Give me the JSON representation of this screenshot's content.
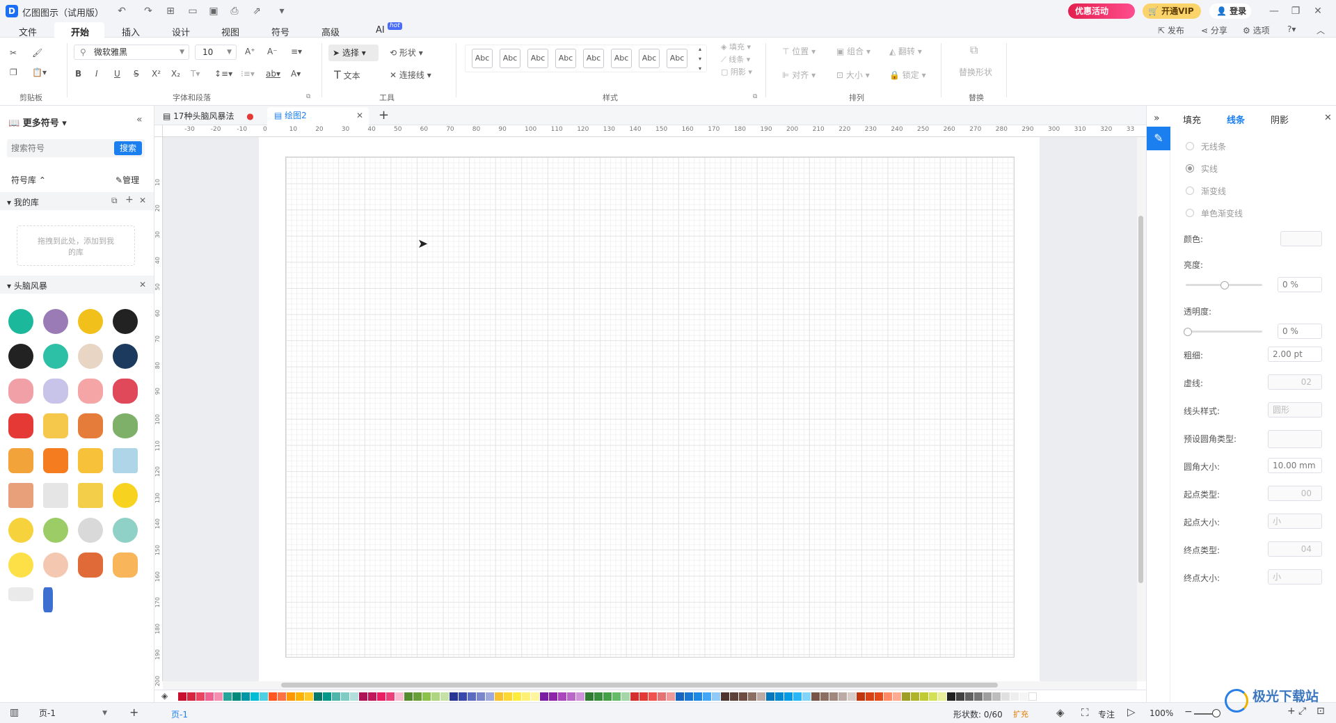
{
  "app": {
    "title": "亿图图示（试用版）",
    "promo_label": "优惠活动",
    "vip_label": "开通VIP",
    "login_label": "登录"
  },
  "menu": {
    "items": [
      "文件",
      "开始",
      "插入",
      "设计",
      "视图",
      "符号",
      "高级",
      "AI"
    ],
    "ai_badge": "hot",
    "publish": "发布",
    "share": "分享",
    "options": "选项"
  },
  "ribbon": {
    "font_name": "微软雅黑",
    "font_size": "10",
    "select_label": "选择",
    "shape_label": "形状",
    "text_label": "文本",
    "connector_label": "连接线",
    "style_sample": "Abc",
    "fill_label": "填充",
    "line_label": "线条",
    "shadow_label": "阴影",
    "position_label": "位置",
    "group_label": "组合",
    "flip_label": "翻转",
    "align_label": "对齐",
    "size_label": "大小",
    "lock_label": "锁定",
    "replace_shape_label": "替换形状",
    "groups": {
      "clipboard": "剪贴板",
      "font_para": "字体和段落",
      "tools": "工具",
      "styles": "样式",
      "arrange": "排列",
      "replace": "替换"
    }
  },
  "left_panel": {
    "more_symbols": "更多符号",
    "search_placeholder": "搜索符号",
    "search_button": "搜索",
    "library_label": "符号库",
    "manage_label": "管理",
    "my_library": "我的库",
    "drop_hint": "拖拽到此处，添加到我的库",
    "category": "头脑风暴"
  },
  "tabs": {
    "doc1": "17种头脑风暴法",
    "doc2": "绘图2"
  },
  "ruler": {
    "h_ticks": [
      "-30",
      "-20",
      "-10",
      "0",
      "10",
      "20",
      "30",
      "40",
      "50",
      "60",
      "70",
      "80",
      "90",
      "100",
      "110",
      "120",
      "130",
      "140",
      "150",
      "160",
      "170",
      "180",
      "190",
      "200",
      "210",
      "220",
      "230",
      "240",
      "250",
      "260",
      "270",
      "280",
      "290",
      "300",
      "310",
      "320",
      "33"
    ],
    "v_ticks": [
      "10",
      "20",
      "30",
      "40",
      "50",
      "60",
      "70",
      "80",
      "90",
      "100",
      "110",
      "120",
      "130",
      "140",
      "150",
      "160",
      "170",
      "180",
      "190",
      "200"
    ]
  },
  "right_panel": {
    "tabs": [
      "填充",
      "线条",
      "阴影"
    ],
    "line_options": [
      "无线条",
      "实线",
      "渐变线",
      "单色渐变线"
    ],
    "color_label": "颜色:",
    "brightness_label": "亮度:",
    "brightness_value": "0 %",
    "transparency_label": "透明度:",
    "transparency_value": "0 %",
    "weight_label": "粗细:",
    "weight_value": "2.00 pt",
    "dash_label": "虚线:",
    "dash_value": "02",
    "cap_label": "线头样式:",
    "cap_value": "圆形",
    "corner_type_label": "预设圆角类型:",
    "corner_size_label": "圆角大小:",
    "corner_size_value": "10.00 mm",
    "start_type_label": "起点类型:",
    "start_type_value": "00",
    "start_size_label": "起点大小:",
    "start_size_value": "小",
    "end_type_label": "终点类型:",
    "end_type_value": "04",
    "end_size_label": "终点大小:",
    "end_size_value": "小"
  },
  "status": {
    "page_select": "页-1",
    "page_tab": "页-1",
    "shape_count": "形状数: 0/60",
    "expand": "扩充",
    "focus": "专注",
    "zoom": "100%",
    "watermark": "极光下载站"
  },
  "palette": [
    "#c8102e",
    "#d7263d",
    "#e94560",
    "#f06292",
    "#f48fb1",
    "#26a69a",
    "#00897b",
    "#0097a7",
    "#00bcd4",
    "#4dd0e1",
    "#ff5722",
    "#ff7043",
    "#ff9800",
    "#ffb300",
    "#ffca28",
    "#00796b",
    "#009688",
    "#4db6ac",
    "#80cbc4",
    "#b2dfdb",
    "#ad1457",
    "#c2185b",
    "#e91e63",
    "#ec407a",
    "#f8bbd0",
    "#558b2f",
    "#689f38",
    "#8bc34a",
    "#aed581",
    "#c5e1a5",
    "#283593",
    "#3949ab",
    "#5c6bc0",
    "#7986cb",
    "#9fa8da",
    "#fbc02d",
    "#fdd835",
    "#ffeb3b",
    "#fff176",
    "#fff59d",
    "#7b1fa2",
    "#8e24aa",
    "#ab47bc",
    "#ba68c8",
    "#ce93d8",
    "#2e7d32",
    "#388e3c",
    "#43a047",
    "#66bb6a",
    "#a5d6a7",
    "#d32f2f",
    "#e53935",
    "#ef5350",
    "#e57373",
    "#ef9a9a",
    "#1565c0",
    "#1976d2",
    "#1e88e5",
    "#42a5f5",
    "#90caf9",
    "#4e342e",
    "#5d4037",
    "#6d4c41",
    "#8d6e63",
    "#bcaaa4",
    "#0277bd",
    "#0288d1",
    "#039be5",
    "#29b6f6",
    "#81d4fa",
    "#795548",
    "#8d6e63",
    "#a1887f",
    "#bcaaa4",
    "#d7ccc8",
    "#bf360c",
    "#d84315",
    "#e64a19",
    "#ff8a65",
    "#ffab91",
    "#9e9d24",
    "#afb42b",
    "#c0ca33",
    "#d4e157",
    "#e6ee9c",
    "#212121",
    "#424242",
    "#616161",
    "#757575",
    "#9e9e9e",
    "#bdbdbd",
    "#e0e0e0",
    "#eeeeee",
    "#f5f5f5",
    "#ffffff"
  ]
}
